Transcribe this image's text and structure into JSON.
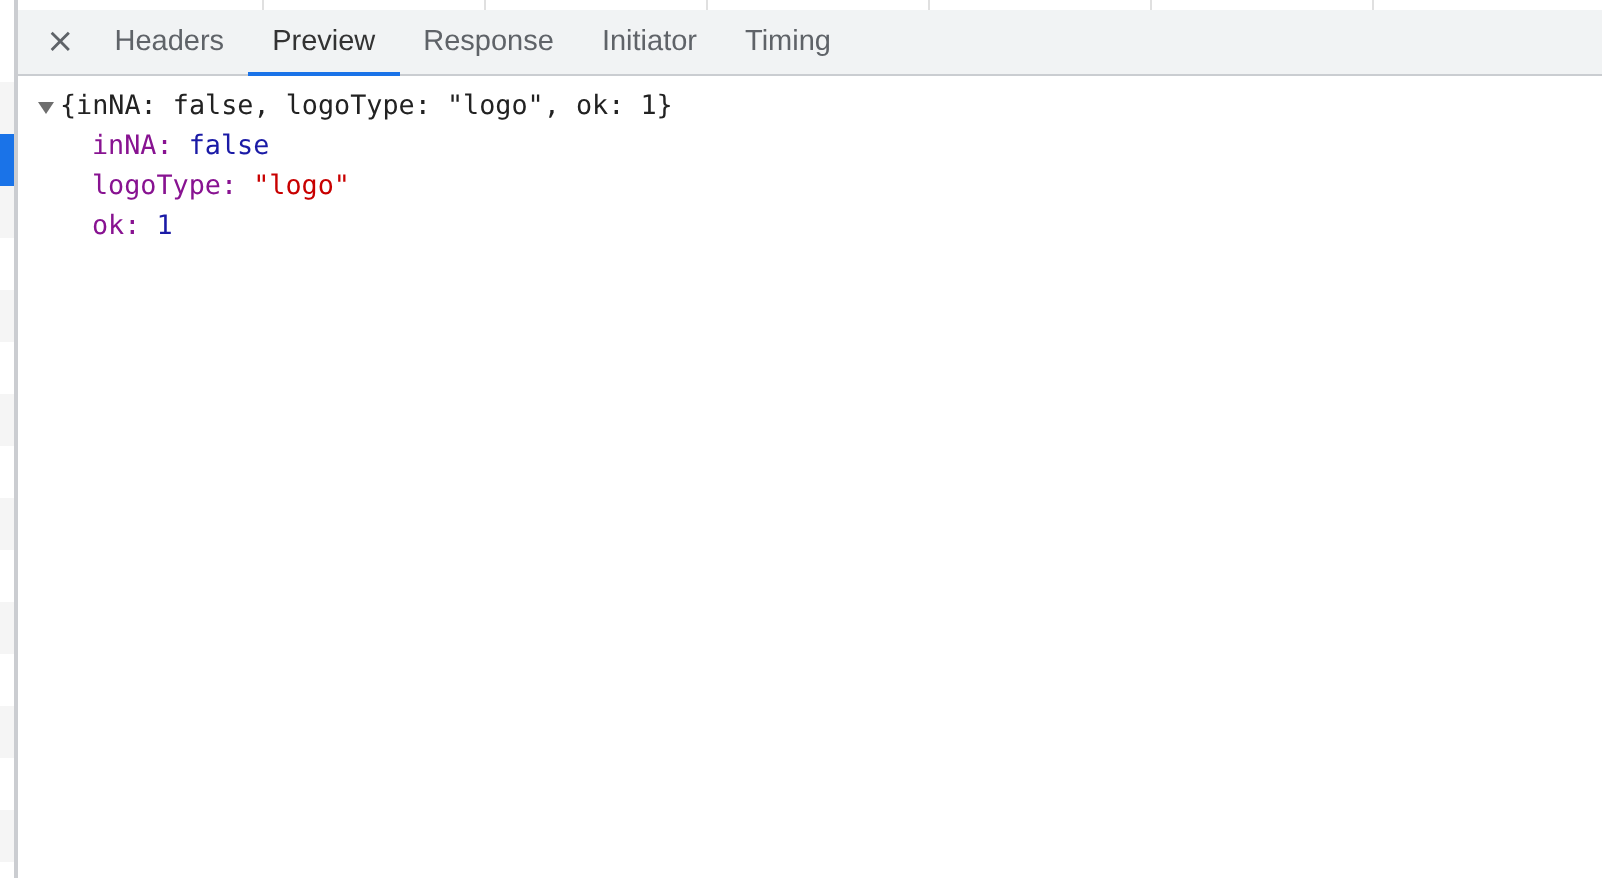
{
  "request_list": {
    "rows": [
      {
        "selected": false
      },
      {
        "selected": false
      },
      {
        "selected": true
      },
      {
        "selected": false
      },
      {
        "selected": false
      },
      {
        "selected": false
      },
      {
        "selected": false
      },
      {
        "selected": false
      },
      {
        "selected": false
      },
      {
        "selected": false
      },
      {
        "selected": false
      },
      {
        "selected": false
      },
      {
        "selected": false
      },
      {
        "selected": false
      },
      {
        "selected": false
      },
      {
        "selected": false
      }
    ]
  },
  "tabs": [
    {
      "label": "Headers",
      "selected": false
    },
    {
      "label": "Preview",
      "selected": true
    },
    {
      "label": "Response",
      "selected": false
    },
    {
      "label": "Initiator",
      "selected": false
    },
    {
      "label": "Timing",
      "selected": false
    }
  ],
  "close_button": "×",
  "preview": {
    "summary": "{inNA: false, logoType: \"logo\", ok: 1}",
    "expanded": true,
    "properties": [
      {
        "key": "inNA:",
        "value": "false",
        "kind": "boolean"
      },
      {
        "key": "logoType:",
        "value": "\"logo\"",
        "kind": "string"
      },
      {
        "key": "ok:",
        "value": "1",
        "kind": "number"
      }
    ]
  }
}
